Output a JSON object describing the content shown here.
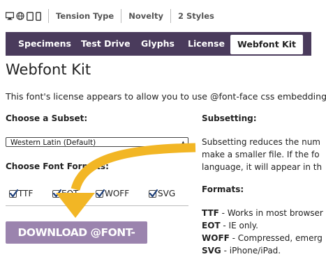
{
  "topbar": {
    "devices": [
      {
        "icon": "desktop-icon"
      },
      {
        "icon": "globe-icon"
      },
      {
        "icon": "tablet-icon"
      },
      {
        "icon": "phone-icon"
      }
    ],
    "crumbs": [
      "Tension Type",
      "Novelty",
      "2 Styles"
    ]
  },
  "tabs": [
    {
      "label": "Specimens"
    },
    {
      "label": "Test Drive"
    },
    {
      "label": "Glyphs"
    },
    {
      "label": "License"
    },
    {
      "label": "Webfont Kit",
      "active": true
    }
  ],
  "page": {
    "title": "Webfont Kit",
    "intro": "This font's license appears to allow you to use @font-face css embedding!"
  },
  "left": {
    "subset_label": "Choose a Subset:",
    "subset_value": "Western Latin (Default)",
    "formats_label": "Choose Font Formats:",
    "formats": [
      {
        "label": "TTF",
        "checked": true
      },
      {
        "label": "EOT",
        "checked": true
      },
      {
        "label": "WOFF",
        "checked": true
      },
      {
        "label": "SVG",
        "checked": true
      }
    ],
    "download_label": "DOWNLOAD @FONT-FACE KIT"
  },
  "right": {
    "subsetting_heading": "Subsetting:",
    "subsetting_lines": [
      "Subsetting reduces the num",
      "make a smaller file. If the fo",
      "language, it will appear in th"
    ],
    "formats_heading": "Formats:",
    "format_notes": [
      {
        "name": "TTF",
        "text": " - Works in most browser"
      },
      {
        "name": "EOT",
        "text": " - IE only."
      },
      {
        "name": "WOFF",
        "text": " - Compressed, emerg"
      },
      {
        "name": "SVG",
        "text": " - iPhone/iPad."
      }
    ]
  },
  "colors": {
    "tabbar": "#4a3b5c",
    "button": "#9b84ae",
    "arrow": "#f2b625"
  }
}
